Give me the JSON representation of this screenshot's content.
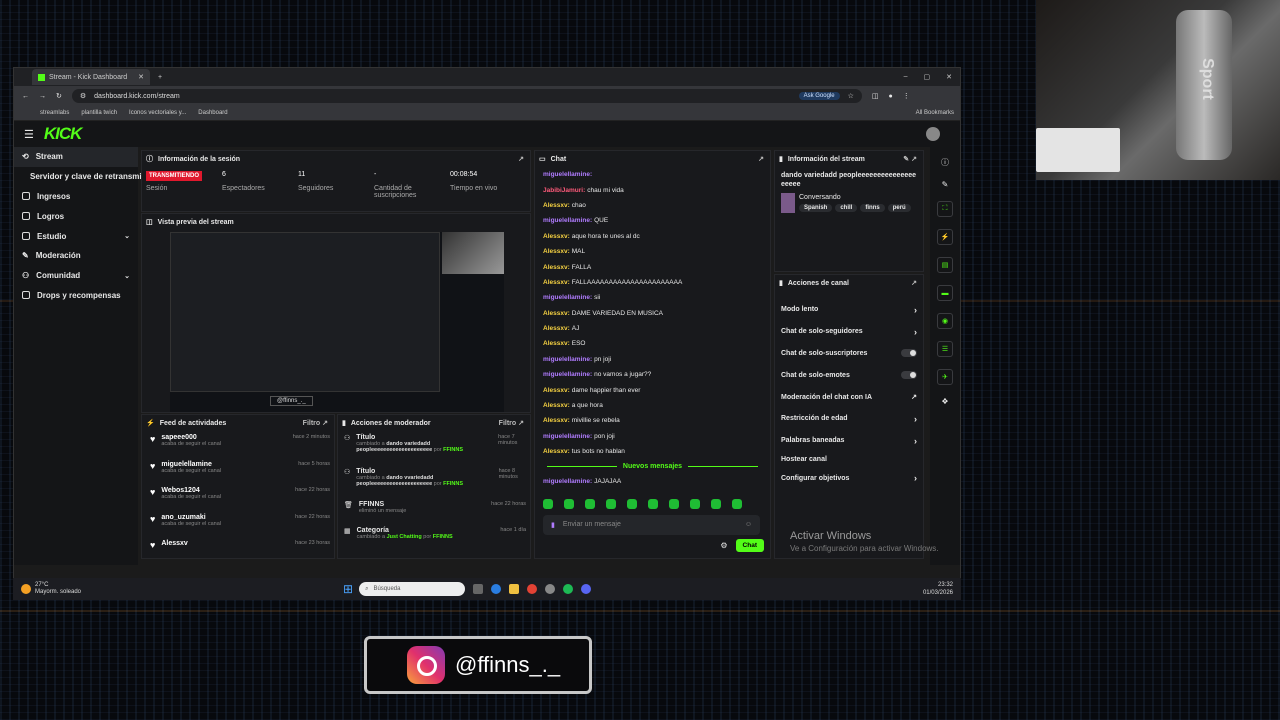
{
  "browser": {
    "tab_title": "Stream - Kick Dashboard",
    "url": "dashboard.kick.com/stream",
    "ask_google": "Ask Google",
    "bookmarks": [
      "streamlabs",
      "plantilla twich",
      "Iconos vectoriales y...",
      "Dashboard"
    ],
    "all_bookmarks": "All Bookmarks"
  },
  "app": {
    "logo": "KICK"
  },
  "sidebar": {
    "items": [
      {
        "label": "Stream",
        "icon": "stream-icon"
      },
      {
        "label": "Servidor y clave de retransmisión",
        "icon": ""
      },
      {
        "label": "Ingresos",
        "icon": "income-icon"
      },
      {
        "label": "Logros",
        "icon": "trophy-icon"
      },
      {
        "label": "Estudio",
        "icon": "studio-icon"
      },
      {
        "label": "Moderación",
        "icon": "shield-icon"
      },
      {
        "label": "Comunidad",
        "icon": "community-icon"
      },
      {
        "label": "Drops y recompensas",
        "icon": "gift-icon"
      }
    ]
  },
  "session": {
    "title": "Información de la sesión",
    "status": "TRANSMITIENDO",
    "stats": [
      {
        "label": "Sesión",
        "value": ""
      },
      {
        "label": "Espectadores",
        "value": "6"
      },
      {
        "label": "Seguidores",
        "value": "11"
      },
      {
        "label": "Cantidad de suscripciones",
        "value": "-"
      },
      {
        "label": "Tiempo en vivo",
        "value": "00:08:54"
      }
    ]
  },
  "preview": {
    "title": "Vista previa del stream",
    "overlay": "@ffinns_._"
  },
  "feed": {
    "title": "Feed de actividades",
    "filter": "Filtro",
    "items": [
      {
        "name": "sapeee000",
        "sub": "acaba de seguir el canal",
        "time": "hace 2 minutos"
      },
      {
        "name": "miguelellamine",
        "sub": "acaba de seguir el canal",
        "time": "hace 5 horas"
      },
      {
        "name": "Webos1204",
        "sub": "acaba de seguir el canal",
        "time": "hace 22 horas"
      },
      {
        "name": "ano_uzumaki",
        "sub": "acaba de seguir el canal",
        "time": "hace 22 horas"
      },
      {
        "name": "Alessxv",
        "sub": "",
        "time": "hace 23 horas"
      }
    ]
  },
  "mod": {
    "title": "Acciones de moderador",
    "filter": "Filtro",
    "items": [
      {
        "name": "Título",
        "sub": "cambiado a",
        "detail": "dando variedadd peopleeeeeeeeeeeeeeeeeeee",
        "by": "por",
        "who": "FFINNS",
        "time": "hace 7 minutos"
      },
      {
        "name": "Título",
        "sub": "cambiado a",
        "detail": "dando vvariedadd peopleeeeeeeeeeeeeeeeeeee",
        "by": "por",
        "who": "FFINNS",
        "time": "hace 8 minutos"
      },
      {
        "name": "FFINNS",
        "sub": "eliminó un mensaje",
        "detail": "",
        "by": "",
        "who": "",
        "time": "hace 22 horas"
      },
      {
        "name": "Categoría",
        "sub": "cambiado a",
        "detail": "Just Chatting",
        "by": "por",
        "who": "FFINNS",
        "time": "hace 1 día"
      }
    ]
  },
  "chat": {
    "title": "Chat",
    "messages": [
      {
        "user": "miguelellamine:",
        "text": "",
        "color": "#b07cff"
      },
      {
        "user": "JabibiJamuri:",
        "text": "chau mi vida",
        "color": "#ff5a7a"
      },
      {
        "user": "Alessxv:",
        "text": "chao",
        "color": "#f5d142"
      },
      {
        "user": "miguelellamine:",
        "text": "QUE",
        "color": "#b07cff"
      },
      {
        "user": "Alessxv:",
        "text": "aque hora te unes al dc",
        "color": "#f5d142"
      },
      {
        "user": "Alessxv:",
        "text": "MAL",
        "color": "#f5d142"
      },
      {
        "user": "Alessxv:",
        "text": "FALLA",
        "color": "#f5d142"
      },
      {
        "user": "Alessxv:",
        "text": "FALLAAAAAAAAAAAAAAAAAAAAAA",
        "color": "#f5d142"
      },
      {
        "user": "miguelellamine:",
        "text": "sii",
        "color": "#b07cff"
      },
      {
        "user": "Alessxv:",
        "text": "DAME VARIEDAD EN MUSICA",
        "color": "#f5d142"
      },
      {
        "user": "Alessxv:",
        "text": "AJ",
        "color": "#f5d142"
      },
      {
        "user": "Alessxv:",
        "text": "ESO",
        "color": "#f5d142"
      },
      {
        "user": "miguelellamine:",
        "text": "pn joji",
        "color": "#b07cff"
      },
      {
        "user": "miguelellamine:",
        "text": "no vamos a jugar??",
        "color": "#b07cff"
      },
      {
        "user": "Alessxv:",
        "text": "dame happier than ever",
        "color": "#f5d142"
      },
      {
        "user": "Alessxv:",
        "text": "a que hora",
        "color": "#f5d142"
      },
      {
        "user": "Alessxv:",
        "text": "mivillie se rebela",
        "color": "#f5d142"
      },
      {
        "user": "miguelellamine:",
        "text": "pon joji",
        "color": "#b07cff"
      },
      {
        "user": "Alessxv:",
        "text": "tus bots no hablan",
        "color": "#f5d142"
      }
    ],
    "new_messages": "Nuevos mensajes",
    "last": {
      "user": "miguelellamine:",
      "text": "JAJAJAA"
    },
    "placeholder": "Enviar un mensaje",
    "send": "Chat"
  },
  "stream_info": {
    "title": "Información del stream",
    "stream_title": "dando variedadd peopleeeeeeeeeeeeeeeeeeee",
    "category": "Conversando",
    "tags": [
      "Spanish",
      "chill",
      "finns",
      "perú"
    ]
  },
  "channel_actions": {
    "title": "Acciones de canal",
    "items": [
      {
        "label": "Modo lento",
        "ctrl": "›"
      },
      {
        "label": "Chat de solo-seguidores",
        "ctrl": "›"
      },
      {
        "label": "Chat de solo-suscriptores",
        "ctrl": "toggle"
      },
      {
        "label": "Chat de solo-emotes",
        "ctrl": "toggle"
      },
      {
        "label": "Moderación del chat con IA",
        "ctrl": "↗"
      },
      {
        "label": "Restricción de edad",
        "ctrl": "›"
      },
      {
        "label": "Palabras baneadas",
        "ctrl": "›"
      },
      {
        "label": "Hostear canal",
        "ctrl": ""
      },
      {
        "label": "Configurar objetivos",
        "ctrl": "›"
      }
    ]
  },
  "windows_activation": {
    "line1": "Activar Windows",
    "line2": "Ve a Configuración para activar Windows."
  },
  "taskbar": {
    "temp": "27°C",
    "weather": "Mayorm. soleado",
    "search": "Búsqueda",
    "time": "23:32",
    "date": "01/03/2026"
  },
  "overlay": {
    "instagram": "@ffinns_._"
  }
}
